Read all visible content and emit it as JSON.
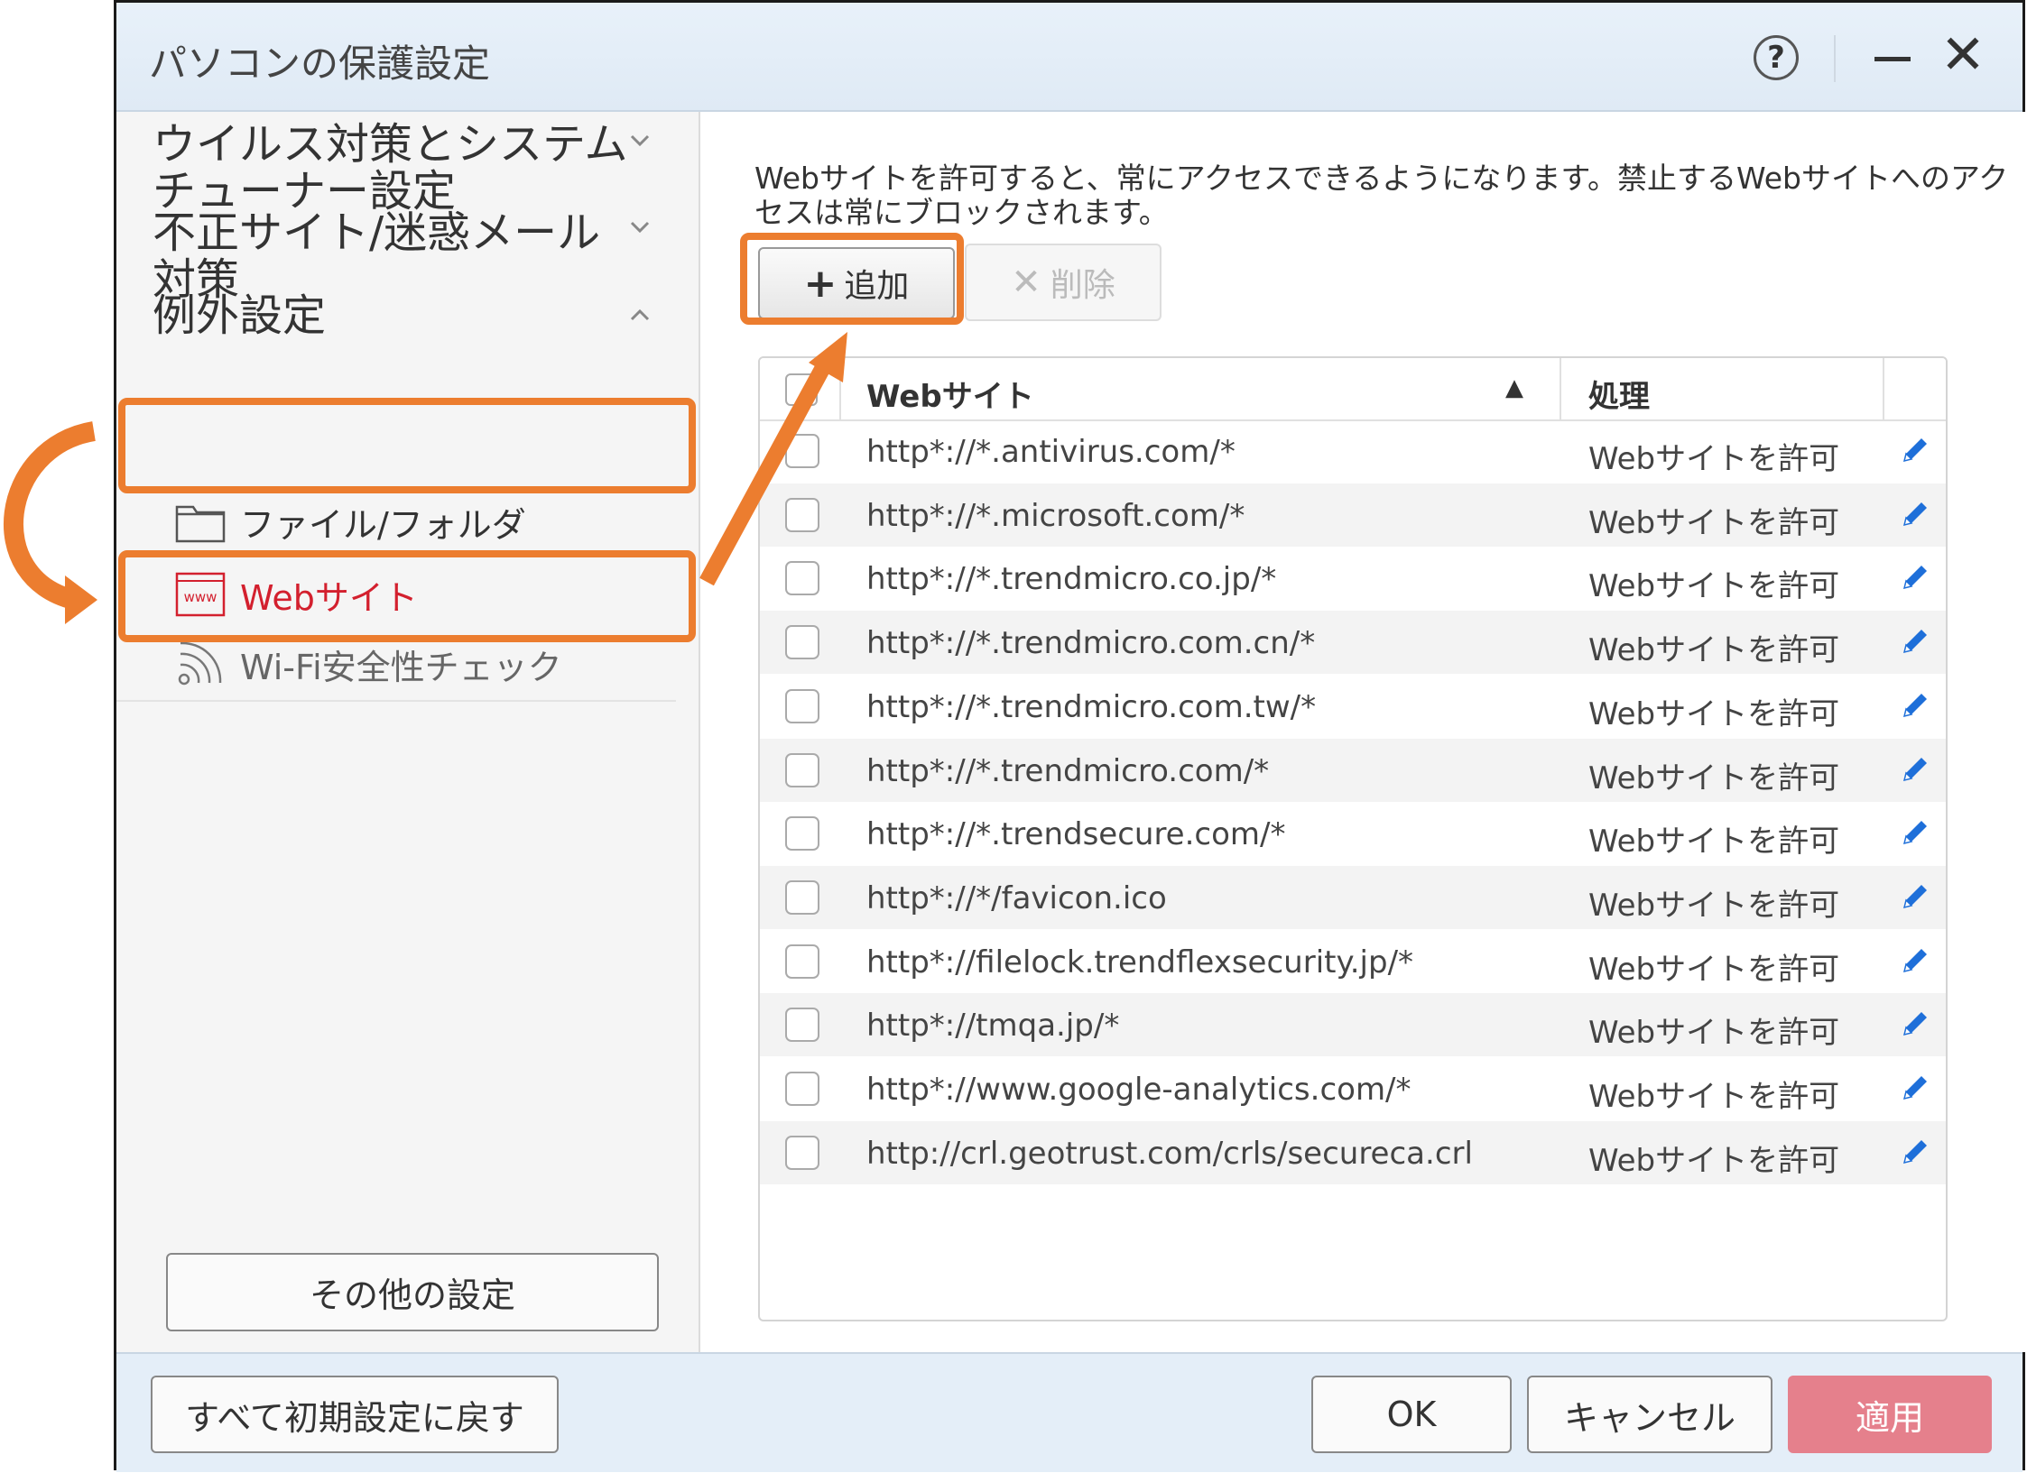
{
  "window": {
    "title": "パソコンの保護設定",
    "help_glyph": "?",
    "close_glyph": "✕"
  },
  "sidebar": {
    "groups": [
      {
        "label": "ウイルス対策とシステム\nチューナー設定",
        "expanded": false
      },
      {
        "label": "不正サイト/迷惑メール\n対策",
        "expanded": false
      },
      {
        "label": "例外設定",
        "expanded": true
      }
    ],
    "sub_items": [
      {
        "label": "ファイル/フォルダ",
        "icon": "folder-icon",
        "state": "normal"
      },
      {
        "label": "Webサイト",
        "icon": "www-icon",
        "icon_text": "www",
        "state": "active"
      },
      {
        "label": "Wi-Fi安全性チェック",
        "icon": "wifi-icon",
        "state": "dim"
      }
    ],
    "other_settings_label": "その他の設定"
  },
  "content": {
    "description": "Webサイトを許可すると、常にアクセスできるようになります。禁止するWebサイトへのアクセスは常にブロックされます。",
    "add_label": "追加",
    "delete_label": "削除",
    "table": {
      "col_site": "Webサイト",
      "col_action": "処理",
      "rows": [
        {
          "site": "http*://*.antivirus.com/*",
          "action": "Webサイトを許可"
        },
        {
          "site": "http*://*.microsoft.com/*",
          "action": "Webサイトを許可"
        },
        {
          "site": "http*://*.trendmicro.co.jp/*",
          "action": "Webサイトを許可"
        },
        {
          "site": "http*://*.trendmicro.com.cn/*",
          "action": "Webサイトを許可"
        },
        {
          "site": "http*://*.trendmicro.com.tw/*",
          "action": "Webサイトを許可"
        },
        {
          "site": "http*://*.trendmicro.com/*",
          "action": "Webサイトを許可"
        },
        {
          "site": "http*://*.trendsecure.com/*",
          "action": "Webサイトを許可"
        },
        {
          "site": "http*://*/favicon.ico",
          "action": "Webサイトを許可"
        },
        {
          "site": "http*://filelock.trendflexsecurity.jp/*",
          "action": "Webサイトを許可"
        },
        {
          "site": "http*://tmqa.jp/*",
          "action": "Webサイトを許可"
        },
        {
          "site": "http*://www.google-analytics.com/*",
          "action": "Webサイトを許可"
        },
        {
          "site": "http://crl.geotrust.com/crls/secureca.crl",
          "action": "Webサイトを許可"
        }
      ]
    }
  },
  "footer": {
    "reset_label": "すべて初期設定に戻す",
    "ok_label": "OK",
    "cancel_label": "キャンセル",
    "apply_label": "適用"
  },
  "colors": {
    "accent_red": "#d3202e",
    "highlight_orange": "#ec7d2f",
    "apply_pink": "#e5808c",
    "edit_blue": "#1e6fd9"
  }
}
